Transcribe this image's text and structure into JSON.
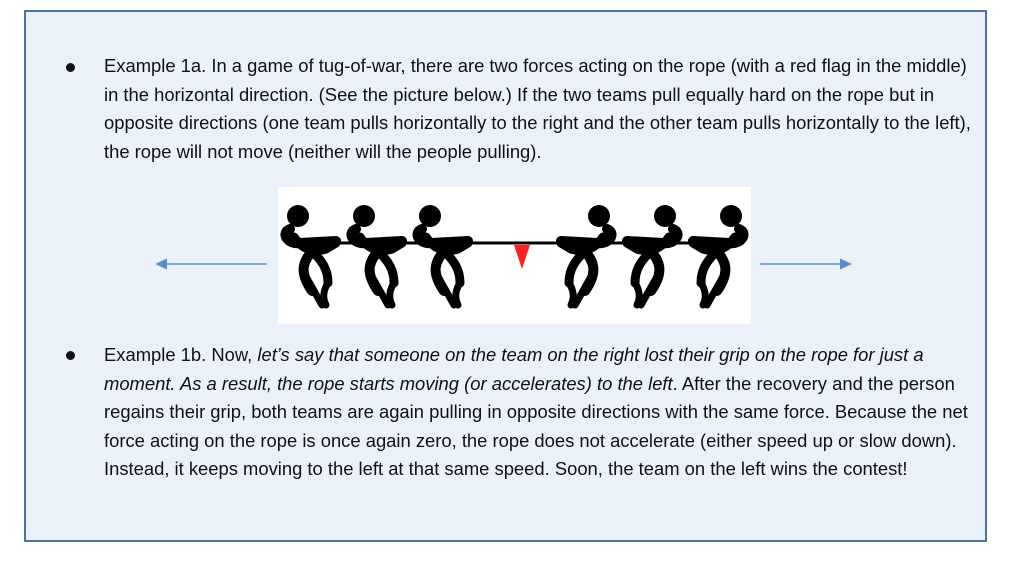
{
  "example_1a": {
    "label": "Example 1a.",
    "text": "In a game of tug-of-war, there are two forces acting on the rope (with a red flag in the middle) in the horizontal direction. (See the picture below.) If the two teams pull equally hard on the rope but in opposite directions (one team pulls horizontally to the right and the other team pulls horizontally to the left), the rope will not move (neither will the people pulling)."
  },
  "figure": {
    "icon": "tug-of-war-icon",
    "left_arrow_icon": "arrow-left-icon",
    "right_arrow_icon": "arrow-right-icon",
    "flag_color": "#ff2020",
    "arrow_color": "#5b8fc9"
  },
  "example_1b": {
    "label": "Example 1b.",
    "intro": "Now,",
    "italic": "let’s say that someone on the team on the right lost their grip on the rope for just a moment. As a result, the rope starts moving (or accelerates) to the left",
    "rest": ". After the recovery and the person regains their grip, both teams are again pulling in opposite directions with the same force. Because the net force acting on the rope is once again zero, the rope does not accelerate (either speed up or slow down). Instead, it keeps moving to the left at that same speed. Soon, the team on the left wins the contest!"
  },
  "colors": {
    "box_background": "#eaf1f9",
    "box_border": "#4a73a8"
  }
}
